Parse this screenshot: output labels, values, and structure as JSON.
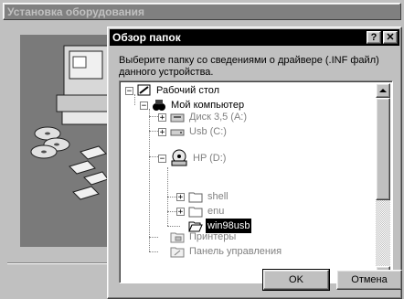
{
  "background_window": {
    "title": "Установка оборудования"
  },
  "dialog": {
    "title": "Обзор папок",
    "help_label": "?",
    "close_label": "✕",
    "prompt": "Выберите папку со сведениями о драйвере (.INF файл) данного устройства.",
    "tree": {
      "desktop": "Рабочий стол",
      "my_computer": "Мой компьютер",
      "floppy": "Диск 3,5 (A:)",
      "usb": "Usb (C:)",
      "hp": "HP (D:)",
      "shell": "shell",
      "enu": "enu",
      "win98usb": "win98usb",
      "printers": "Принтеры",
      "control_panel": "Панель управления"
    },
    "ok_label": "OK",
    "cancel_label": "Отмена"
  }
}
